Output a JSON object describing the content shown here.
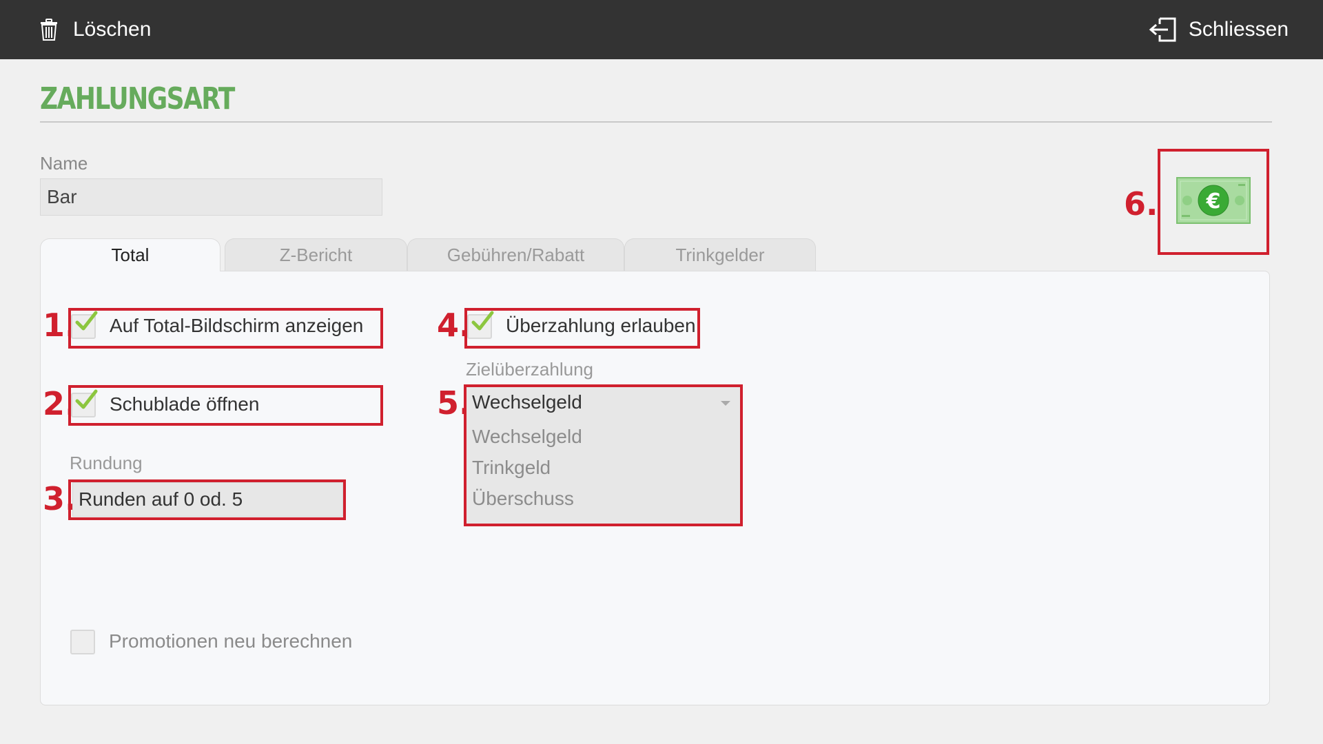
{
  "topbar": {
    "delete_label": "Löschen",
    "close_label": "Schliessen"
  },
  "page": {
    "title": "ZAHLUNGSART"
  },
  "name_field": {
    "label": "Name",
    "value": "Bar"
  },
  "tabs": [
    {
      "label": "Total",
      "active": true
    },
    {
      "label": "Z-Bericht",
      "active": false
    },
    {
      "label": "Gebühren/Rabatt",
      "active": false
    },
    {
      "label": "Trinkgelder",
      "active": false
    }
  ],
  "annotations": [
    "1.",
    "2.",
    "3.",
    "4.",
    "5.",
    "6."
  ],
  "total_tab": {
    "show_on_total_screen": {
      "label": "Auf Total-Bildschirm anzeigen",
      "checked": true
    },
    "open_drawer": {
      "label": "Schublade öffnen",
      "checked": true
    },
    "rounding": {
      "label": "Rundung",
      "value": "Runden auf 0 od. 5"
    },
    "allow_overpayment": {
      "label": "Überzahlung erlauben",
      "checked": true
    },
    "overpayment_target": {
      "label": "Zielüberzahlung",
      "selected": "Wechselgeld",
      "options": [
        "Wechselgeld",
        "Trinkgeld",
        "Überschuss"
      ]
    },
    "recalculate_promotions": {
      "label": "Promotionen neu berechnen",
      "checked": false
    }
  },
  "payment_icon": {
    "name": "euro-banknote-icon",
    "symbol": "€"
  },
  "colors": {
    "topbar": "#333333",
    "title_green": "#66ab5c",
    "check_green": "#8cc63f",
    "annotation_red": "#d0202e",
    "banknote_green": "#3aaa35"
  }
}
